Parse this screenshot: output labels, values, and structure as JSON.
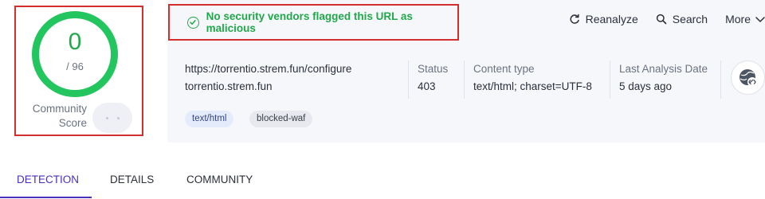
{
  "score": {
    "detections": "0",
    "total": "/ 96",
    "community_label": "Community Score",
    "ring_color": "#22c55e"
  },
  "verdict": {
    "text": "No security vendors flagged this URL as malicious",
    "icon": "check-circle-icon",
    "color": "#22a84a"
  },
  "actions": {
    "reanalyze": "Reanalyze",
    "search": "Search",
    "more": "More"
  },
  "info": {
    "url": "https://torrentio.strem.fun/configure",
    "domain": "torrentio.strem.fun",
    "status_label": "Status",
    "status_value": "403",
    "content_type_label": "Content type",
    "content_type_value": "text/html; charset=UTF-8",
    "last_analysis_label": "Last Analysis Date",
    "last_analysis_value": "5 days ago",
    "tags": [
      "text/html",
      "blocked-waf"
    ]
  },
  "tabs": [
    {
      "label": "DETECTION",
      "active": true
    },
    {
      "label": "DETAILS",
      "active": false
    },
    {
      "label": "COMMUNITY",
      "active": false
    }
  ],
  "accent_color": "#4a2fbd"
}
